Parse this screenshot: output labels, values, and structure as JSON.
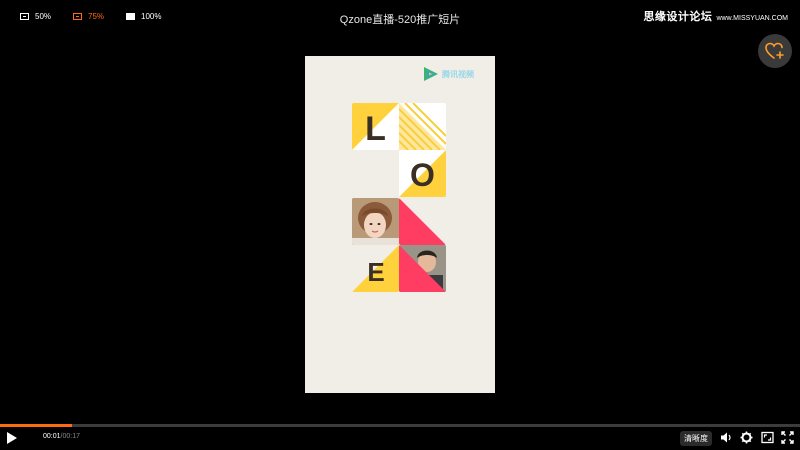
{
  "top": {
    "size_options": [
      {
        "label": "50%"
      },
      {
        "label": "75%"
      },
      {
        "label": "100%"
      }
    ],
    "title": "Qzone直播-520推广短片",
    "watermark": "思缘设计论坛",
    "watermark_url": "www.MISSYUAN.COM"
  },
  "video": {
    "logo_text": "腾讯视频",
    "letters": [
      "L",
      "O",
      "E"
    ]
  },
  "player": {
    "current_time": "00:01",
    "separator": "/",
    "duration": "00:17",
    "progress": 0.09,
    "quality_label": "清晰度",
    "accent": "#ff6a13"
  }
}
